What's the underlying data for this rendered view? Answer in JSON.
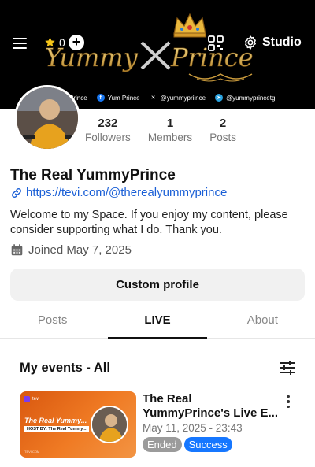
{
  "header": {
    "star_count": "0",
    "studio_label": "Studio",
    "banner_wordmark_left": "Yummy",
    "banner_wordmark_right": "Prince",
    "banner_socials": [
      {
        "label": "Prince",
        "icon": "instagram-icon",
        "color": "#e1306c"
      },
      {
        "label": "Yum Prince",
        "icon": "facebook-icon",
        "color": "#1877f2"
      },
      {
        "label": "@yummypriince",
        "icon": "x-icon",
        "color": "#000000"
      },
      {
        "label": "@yummyprincetg",
        "icon": "telegram-icon",
        "color": "#2aa3e0"
      }
    ]
  },
  "profile": {
    "name": "The Real YummyPrince",
    "link": "https://tevi.com/@therealyummyprince",
    "bio": "Welcome to my Space. If you enjoy my content, please consider supporting what I do. Thank you.",
    "joined": "Joined May 7, 2025",
    "custom_profile_label": "Custom profile",
    "stats": [
      {
        "value": "232",
        "label": "Followers"
      },
      {
        "value": "1",
        "label": "Members"
      },
      {
        "value": "2",
        "label": "Posts"
      }
    ]
  },
  "tabs": [
    {
      "label": "Posts",
      "active": false
    },
    {
      "label": "LIVE",
      "active": true
    },
    {
      "label": "About",
      "active": false
    }
  ],
  "events": {
    "title": "My events - All",
    "items": [
      {
        "title_line1": "The Real",
        "title_line2": "YummyPrince's Live E...",
        "date": "May 11, 2025 - 23:43",
        "badges": [
          "Ended",
          "Success"
        ],
        "thumb_brand": "tevi",
        "thumb_title": "The Real Yummy...",
        "thumb_host": "HOST BY: The Real Yummy...",
        "thumb_footer": "TEVI.COM"
      }
    ]
  },
  "colors": {
    "link": "#1a5fd6",
    "success_badge": "#1677ff",
    "ended_badge": "#9b9b9b",
    "thumb_orange": "#f07b24",
    "gold": "#e3b341"
  }
}
